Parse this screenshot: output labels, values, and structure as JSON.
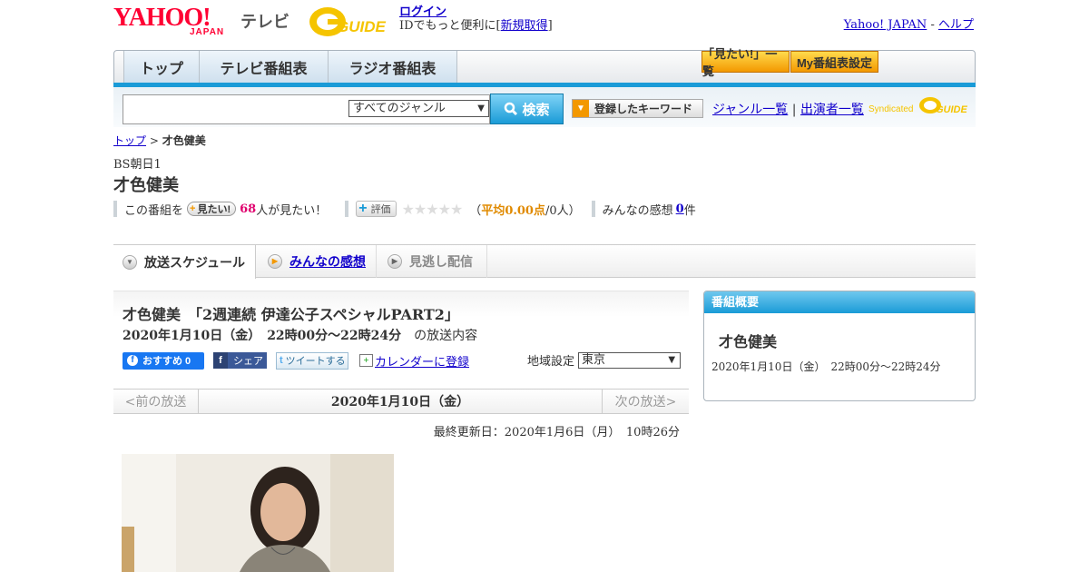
{
  "header": {
    "logo_main": "YAHOO!",
    "logo_sub": "JAPAN",
    "section": "テレビ",
    "gguide_logo": "G GUIDE",
    "login": "ログイン",
    "login_sub_prefix": "IDでもっと便利に[",
    "register": "新規取得",
    "login_sub_suffix": "]",
    "yahoo_japan_link": "Yahoo! JAPAN",
    "dash": " - ",
    "help_link": "ヘルプ"
  },
  "nav": {
    "tabs": [
      "トップ",
      "テレビ番組表",
      "ラジオ番組表"
    ],
    "btn_mitai_list": "「見たい!」一覧",
    "btn_my_schedule": "My番組表設定"
  },
  "search": {
    "placeholder": "",
    "genre_selected": "すべてのジャンル",
    "button": "検索",
    "keyword_button": "登録したキーワード",
    "genre_list": "ジャンル一覧",
    "separator": "|",
    "performer_list": "出演者一覧",
    "syndicated": "Syndicated"
  },
  "breadcrumb": {
    "top": "トップ",
    "sep": " > ",
    "current": "才色健美"
  },
  "program": {
    "channel": "BS朝日1",
    "title": "才色健美",
    "stats_prefix": "この番組を",
    "mitai_btn": "見たい!",
    "mitai_count": "68",
    "mitai_suffix": "人が見たい！",
    "hyoka_btn": "評価",
    "stars": "★★★★★",
    "rating_open": "（",
    "rating_label": "平均0.00点",
    "rating_suffix": "/0人）",
    "impressions_prefix": "みんなの感想",
    "impressions_count": "0",
    "impressions_suffix": "件"
  },
  "tabs": {
    "schedule": "放送スケジュール",
    "impressions": "みんなの感想",
    "missed": "見逃し配信"
  },
  "episode": {
    "title": "才色健美　「2週連続 伊達公子スペシャルPART2」",
    "time_bold": "2020年1月10日（金）　22時00分～22時24分",
    "time_suffix": "の放送内容",
    "fb_like": "おすすめ 0",
    "fb_share": "シェア",
    "tweet": "ツイートする",
    "calendar": "カレンダーに登録",
    "region_label": "地域設定",
    "region_selected": "東京"
  },
  "datenav": {
    "prev": "<前の放送",
    "current": "2020年1月10日（金）",
    "next": "次の放送>"
  },
  "updated": "最終更新日：2020年1月6日（月）　10時26分",
  "sidebar": {
    "heading": "番組概要",
    "title": "才色健美",
    "time": "2020年1月10日（金）　22時00分～22時24分"
  },
  "colors": {
    "accent_blue": "#1a9bd7",
    "accent_orange": "#f39800",
    "yahoo_red": "#ff0033"
  }
}
